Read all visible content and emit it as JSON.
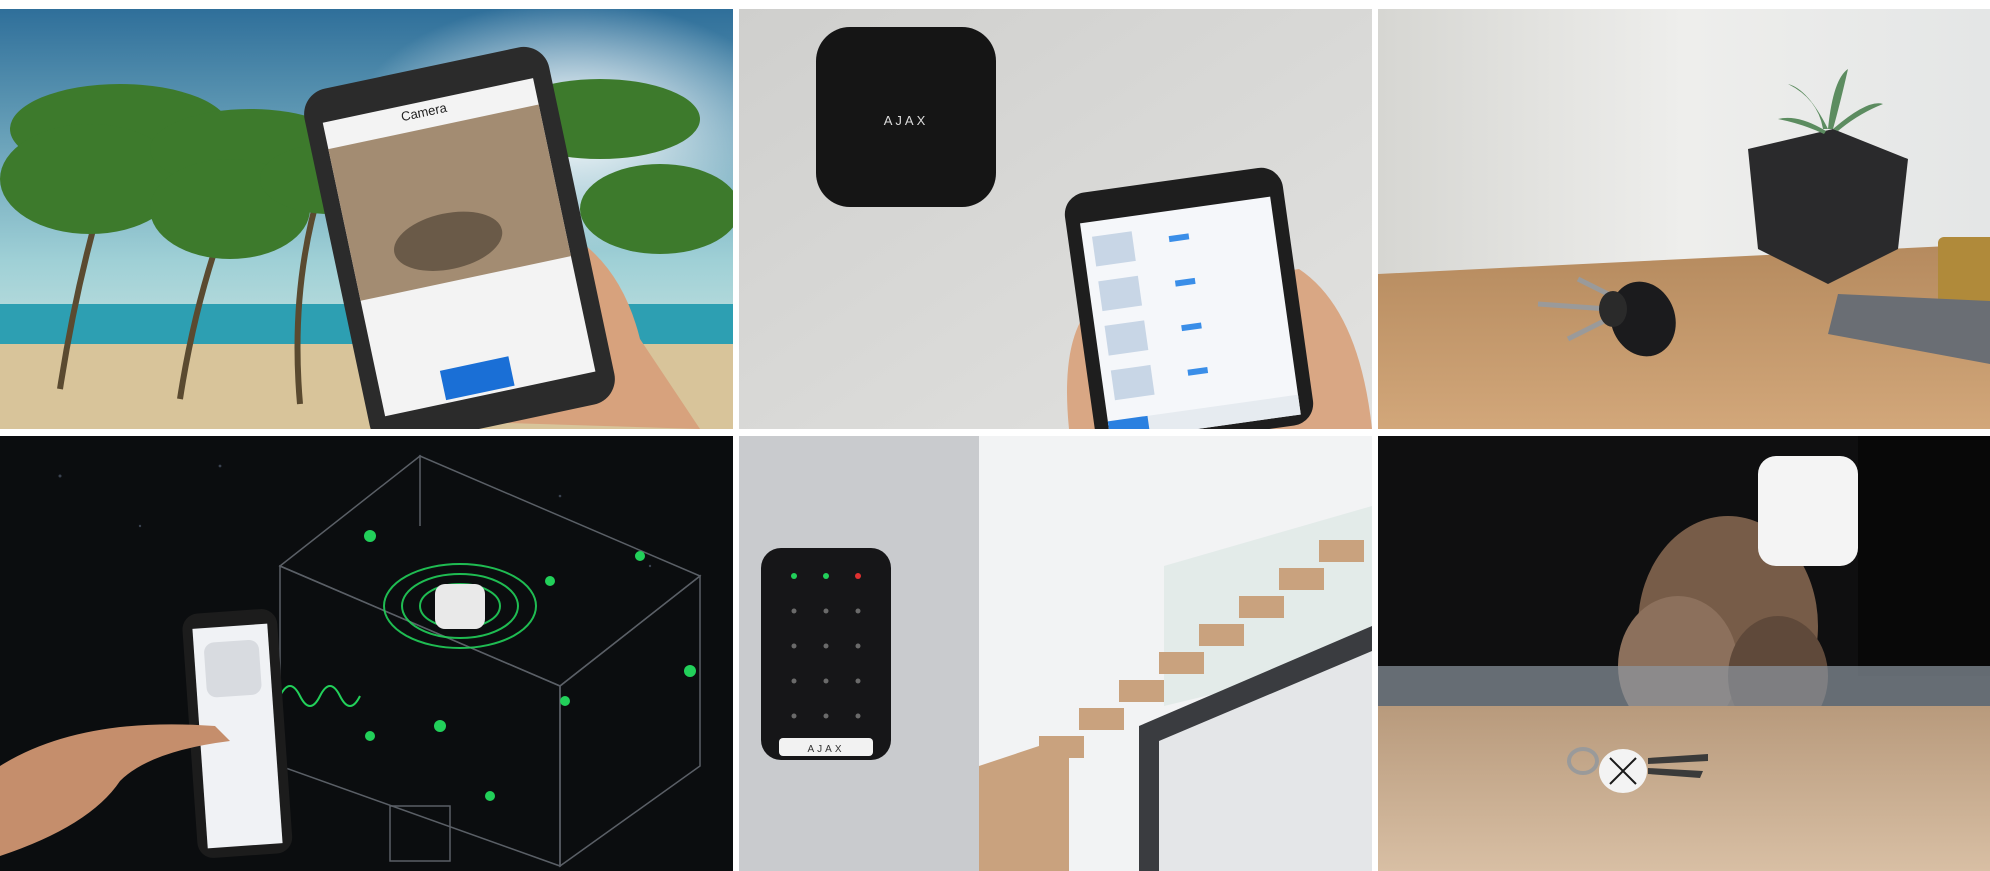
{
  "tiles": [
    {
      "scene": "beach-phone-camera",
      "phone_title": "Camera"
    },
    {
      "scene": "hub-wall-phone-app",
      "brand": "AJAX"
    },
    {
      "scene": "keys-on-table"
    },
    {
      "scene": "smart-home-network"
    },
    {
      "scene": "keypad-stairs",
      "brand": "AJAX"
    },
    {
      "scene": "keyfob-on-shelf"
    }
  ],
  "colors": {
    "sky": "#4a8fb8",
    "sea": "#3aa6b8",
    "wall_light": "#d8d8d6",
    "device_black": "#1a1a1a",
    "accent_green": "#22d05a",
    "wood": "#c89a6a"
  }
}
